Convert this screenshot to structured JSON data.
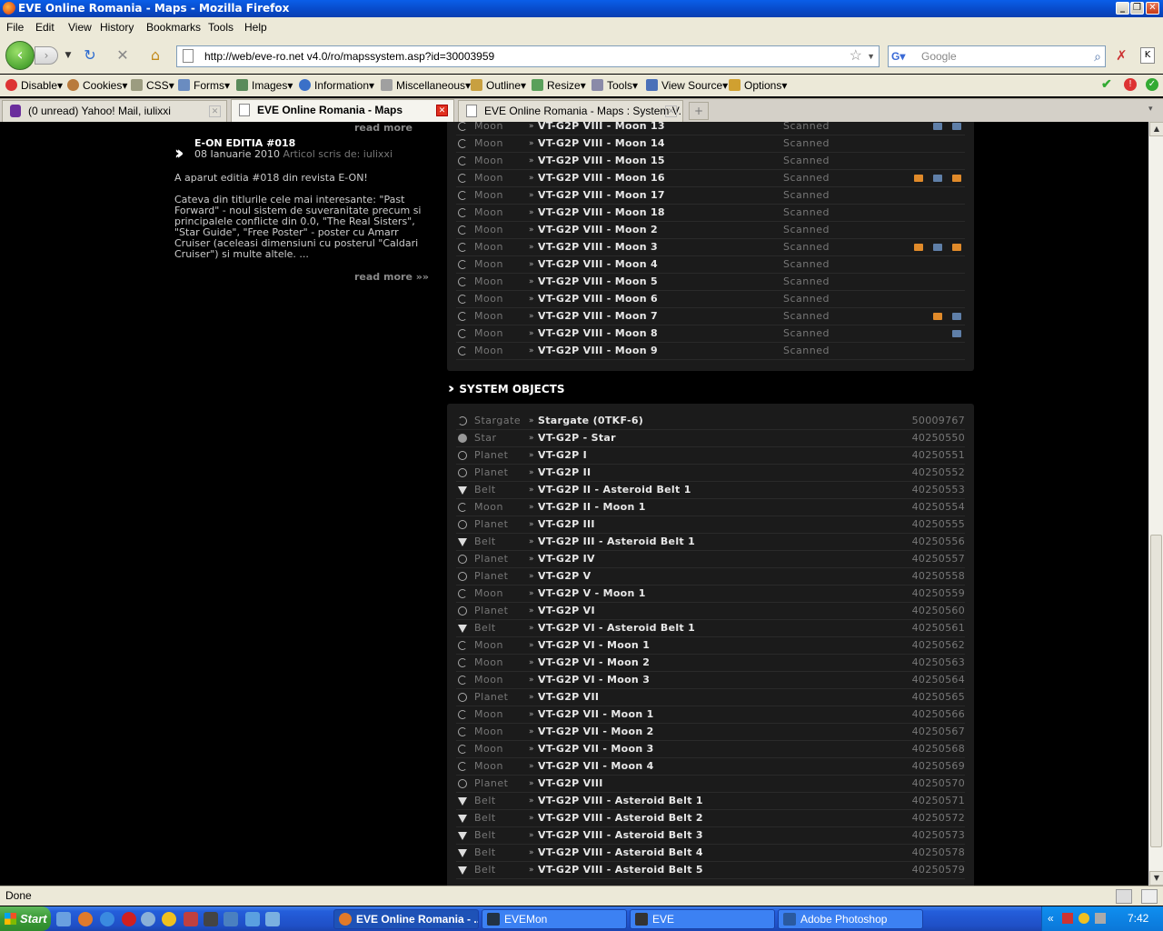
{
  "window": {
    "title": "EVE Online Romania - Maps - Mozilla Firefox"
  },
  "menu": [
    "File",
    "Edit",
    "View",
    "History",
    "Bookmarks",
    "Tools",
    "Help"
  ],
  "url": "http://web/eve-ro.net v4.0/ro/mapssystem.asp?id=30003959",
  "search": {
    "placeholder": "Google"
  },
  "toolbar": [
    "Disable",
    "Cookies",
    "CSS",
    "Forms",
    "Images",
    "Information",
    "Miscellaneous",
    "Outline",
    "Resize",
    "Tools",
    "View Source",
    "Options"
  ],
  "tabs": [
    {
      "label": "(0 unread) Yahoo! Mail, iulixxi"
    },
    {
      "label": "EVE Online Romania - Maps"
    },
    {
      "label": "EVE Online Romania - Maps : System V..."
    }
  ],
  "news": {
    "title": "E-ON EDITIA #018",
    "date": "08 Ianuarie 2010",
    "author": "Articol scris de: iulixxi",
    "intro": "A aparut editia #018 din revista E-ON!",
    "body": "Cateva din titlurile cele mai interesante: \"Past Forward\" - noul sistem de suveranitate precum si principalele conflicte din 0.0, \"The Real Sisters\", \"Star Guide\", \"Free Poster\" - poster cu Amarr Cruiser (aceleasi dimensiuni cu posterul \"Caldari Cruiser\") si multe altele. ...",
    "read_more": "read more »»"
  },
  "moons": [
    {
      "type": "Moon",
      "name": "VT-G2P VIII - Moon 13",
      "status": "Scanned",
      "badges": [
        "blue",
        "blue"
      ]
    },
    {
      "type": "Moon",
      "name": "VT-G2P VIII - Moon 14",
      "status": "Scanned",
      "badges": []
    },
    {
      "type": "Moon",
      "name": "VT-G2P VIII - Moon 15",
      "status": "Scanned",
      "badges": []
    },
    {
      "type": "Moon",
      "name": "VT-G2P VIII - Moon 16",
      "status": "Scanned",
      "badges": [
        "orange",
        "blue",
        "orange"
      ]
    },
    {
      "type": "Moon",
      "name": "VT-G2P VIII - Moon 17",
      "status": "Scanned",
      "badges": []
    },
    {
      "type": "Moon",
      "name": "VT-G2P VIII - Moon 18",
      "status": "Scanned",
      "badges": []
    },
    {
      "type": "Moon",
      "name": "VT-G2P VIII - Moon 2",
      "status": "Scanned",
      "badges": []
    },
    {
      "type": "Moon",
      "name": "VT-G2P VIII - Moon 3",
      "status": "Scanned",
      "badges": [
        "orange",
        "blue",
        "orange"
      ]
    },
    {
      "type": "Moon",
      "name": "VT-G2P VIII - Moon 4",
      "status": "Scanned",
      "badges": []
    },
    {
      "type": "Moon",
      "name": "VT-G2P VIII - Moon 5",
      "status": "Scanned",
      "badges": []
    },
    {
      "type": "Moon",
      "name": "VT-G2P VIII - Moon 6",
      "status": "Scanned",
      "badges": []
    },
    {
      "type": "Moon",
      "name": "VT-G2P VIII - Moon 7",
      "status": "Scanned",
      "badges": [
        "orange",
        "blue"
      ]
    },
    {
      "type": "Moon",
      "name": "VT-G2P VIII - Moon 8",
      "status": "Scanned",
      "badges": [
        "blue"
      ]
    },
    {
      "type": "Moon",
      "name": "VT-G2P VIII - Moon 9",
      "status": "Scanned",
      "badges": []
    }
  ],
  "system_objects_title": "SYSTEM OBJECTS",
  "objects": [
    {
      "type": "Stargate",
      "name": "Stargate (0TKF-6)",
      "id": "50009767"
    },
    {
      "type": "Star",
      "name": "VT-G2P - Star",
      "id": "40250550"
    },
    {
      "type": "Planet",
      "name": "VT-G2P I",
      "id": "40250551"
    },
    {
      "type": "Planet",
      "name": "VT-G2P II",
      "id": "40250552"
    },
    {
      "type": "Belt",
      "name": "VT-G2P II - Asteroid Belt 1",
      "id": "40250553"
    },
    {
      "type": "Moon",
      "name": "VT-G2P II - Moon 1",
      "id": "40250554"
    },
    {
      "type": "Planet",
      "name": "VT-G2P III",
      "id": "40250555"
    },
    {
      "type": "Belt",
      "name": "VT-G2P III - Asteroid Belt 1",
      "id": "40250556"
    },
    {
      "type": "Planet",
      "name": "VT-G2P IV",
      "id": "40250557"
    },
    {
      "type": "Planet",
      "name": "VT-G2P V",
      "id": "40250558"
    },
    {
      "type": "Moon",
      "name": "VT-G2P V - Moon 1",
      "id": "40250559"
    },
    {
      "type": "Planet",
      "name": "VT-G2P VI",
      "id": "40250560"
    },
    {
      "type": "Belt",
      "name": "VT-G2P VI - Asteroid Belt 1",
      "id": "40250561"
    },
    {
      "type": "Moon",
      "name": "VT-G2P VI - Moon 1",
      "id": "40250562"
    },
    {
      "type": "Moon",
      "name": "VT-G2P VI - Moon 2",
      "id": "40250563"
    },
    {
      "type": "Moon",
      "name": "VT-G2P VI - Moon 3",
      "id": "40250564"
    },
    {
      "type": "Planet",
      "name": "VT-G2P VII",
      "id": "40250565"
    },
    {
      "type": "Moon",
      "name": "VT-G2P VII - Moon 1",
      "id": "40250566"
    },
    {
      "type": "Moon",
      "name": "VT-G2P VII - Moon 2",
      "id": "40250567"
    },
    {
      "type": "Moon",
      "name": "VT-G2P VII - Moon 3",
      "id": "40250568"
    },
    {
      "type": "Moon",
      "name": "VT-G2P VII - Moon 4",
      "id": "40250569"
    },
    {
      "type": "Planet",
      "name": "VT-G2P VIII",
      "id": "40250570"
    },
    {
      "type": "Belt",
      "name": "VT-G2P VIII - Asteroid Belt 1",
      "id": "40250571"
    },
    {
      "type": "Belt",
      "name": "VT-G2P VIII - Asteroid Belt 2",
      "id": "40250572"
    },
    {
      "type": "Belt",
      "name": "VT-G2P VIII - Asteroid Belt 3",
      "id": "40250573"
    },
    {
      "type": "Belt",
      "name": "VT-G2P VIII - Asteroid Belt 4",
      "id": "40250578"
    },
    {
      "type": "Belt",
      "name": "VT-G2P VIII - Asteroid Belt 5",
      "id": "40250579"
    }
  ],
  "status": "Done",
  "taskbar": {
    "start": "Start",
    "tasks": [
      "EVE Online Romania - ...",
      "EVEMon",
      "EVE",
      "Adobe Photoshop"
    ],
    "clock": "7:42 PM"
  },
  "colors": {
    "badge_orange": "#e08a2a",
    "badge_blue": "#5f7fa8",
    "panel_bg": "#1b1b1b"
  }
}
